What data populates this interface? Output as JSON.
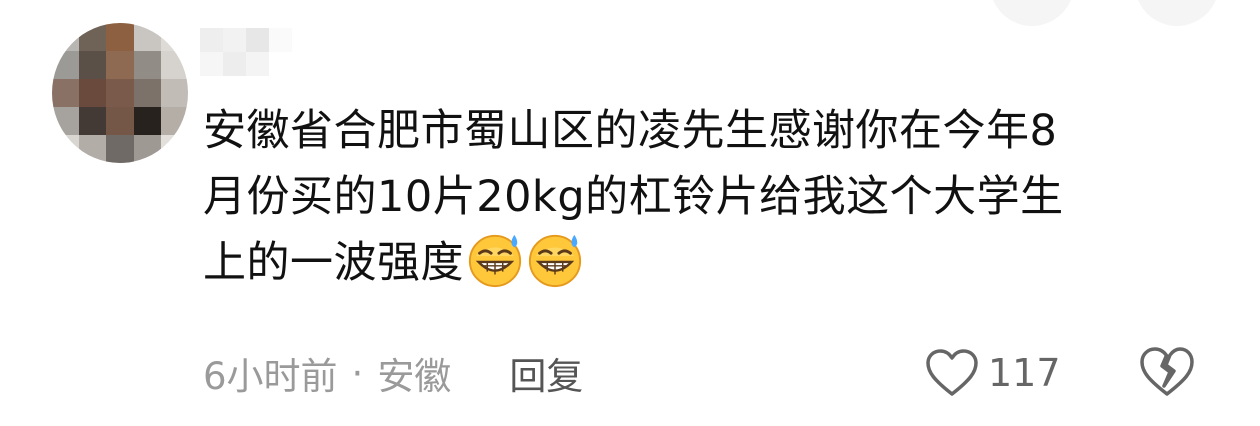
{
  "comment": {
    "avatar_alt": "pixelated avatar",
    "lines": [
      "安徽省合肥市蜀山区的凌先生感谢你在今年8",
      "月份买的10片20kg的杠铃片给我这个大学生",
      "上的一波强度"
    ],
    "emojis": [
      "grinning-sweat-icon",
      "grinning-sweat-icon"
    ],
    "time": "6小时前",
    "separator": "·",
    "location": "安徽",
    "reply_label": "回复",
    "like_count": "117"
  },
  "colors": {
    "text": "#111111",
    "meta": "#9a9a9a",
    "reply": "#555555",
    "icon": "#666666"
  }
}
